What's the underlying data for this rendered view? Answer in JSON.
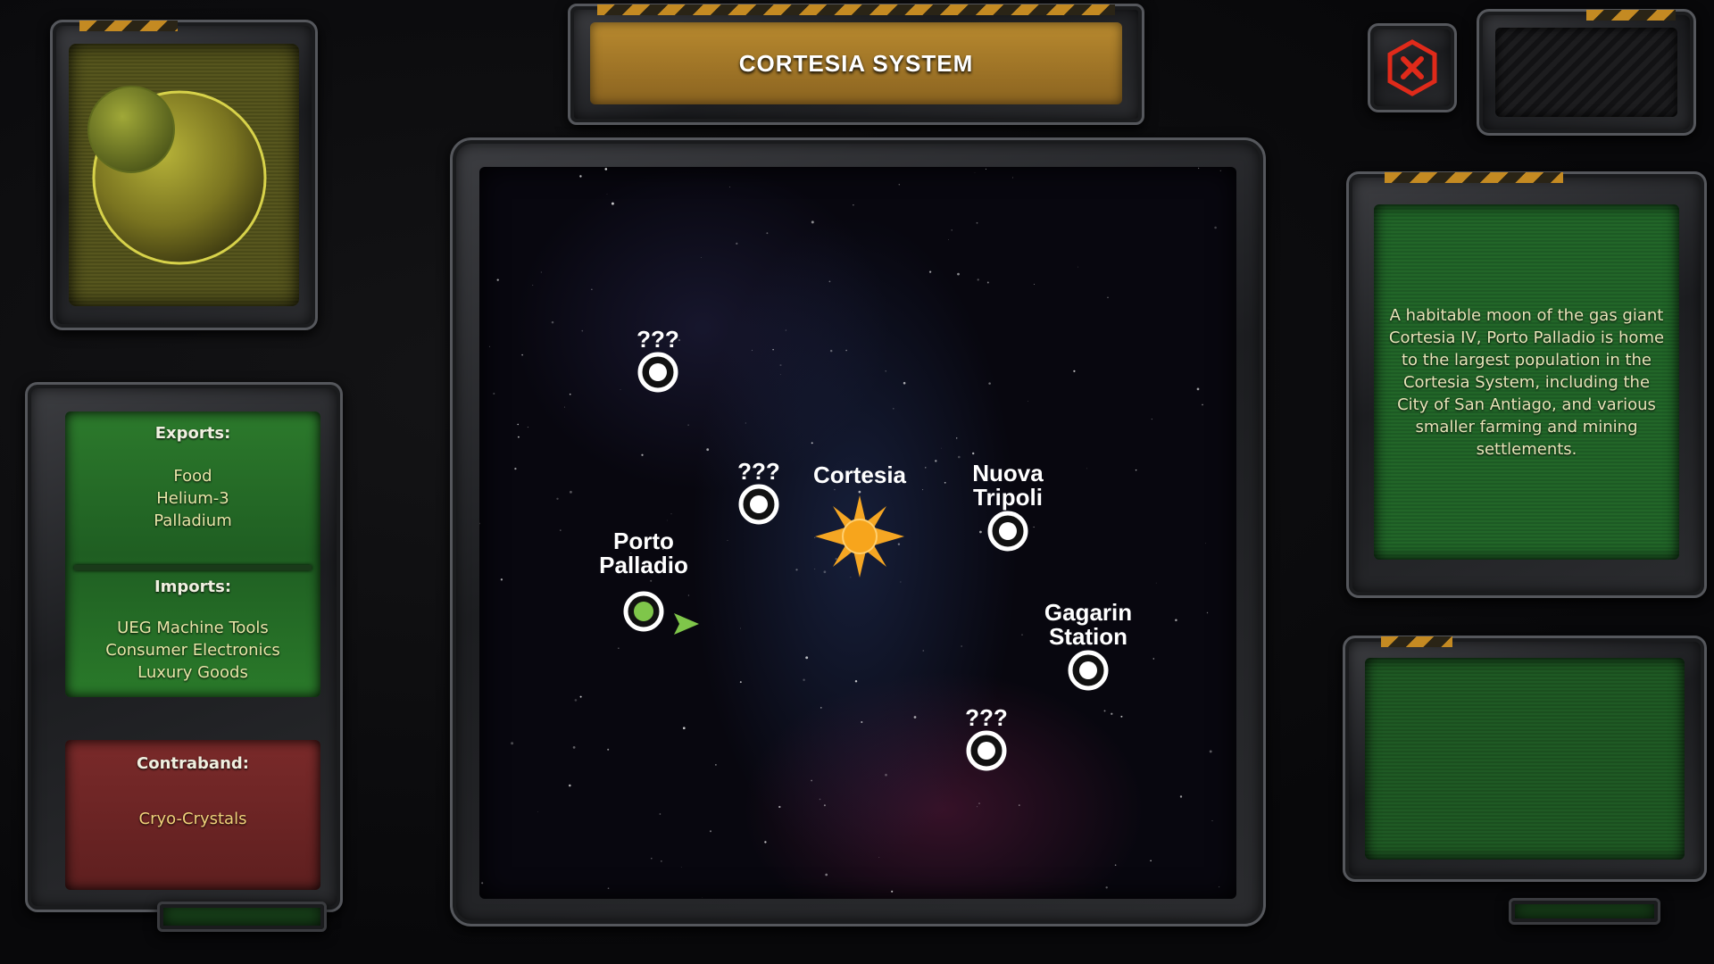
{
  "header": {
    "title": "CORTESIA SYSTEM"
  },
  "close_button": {
    "icon": "close-icon",
    "color": "#e02a1a"
  },
  "trade": {
    "exports_label": "Exports:",
    "exports": [
      "Food",
      "Helium-3",
      "Palladium"
    ],
    "imports_label": "Imports:",
    "imports": [
      "UEG Machine Tools",
      "Consumer Electronics",
      "Luxury Goods"
    ],
    "contraband_label": "Contraband:",
    "contraband": [
      "Cryo-Crystals"
    ]
  },
  "map": {
    "star": {
      "name": "Cortesia",
      "color": "#f5a623"
    },
    "locations": [
      {
        "name": "???",
        "name_line2": "",
        "status": "unknown"
      },
      {
        "name": "???",
        "name_line2": "",
        "status": "unknown"
      },
      {
        "name": "Porto",
        "name_line2": "Palladio",
        "status": "current"
      },
      {
        "name": "Nuova",
        "name_line2": "Tripoli",
        "status": "known"
      },
      {
        "name": "Gagarin",
        "name_line2": "Station",
        "status": "known"
      },
      {
        "name": "???",
        "name_line2": "",
        "status": "unknown"
      }
    ],
    "current_color": "#7fc64a"
  },
  "description": {
    "text": "A habitable moon of the gas giant Cortesia IV, Porto Palladio is home to the largest population in the Cortesia System, including the City of San Antiago, and various smaller farming and mining settlements."
  }
}
